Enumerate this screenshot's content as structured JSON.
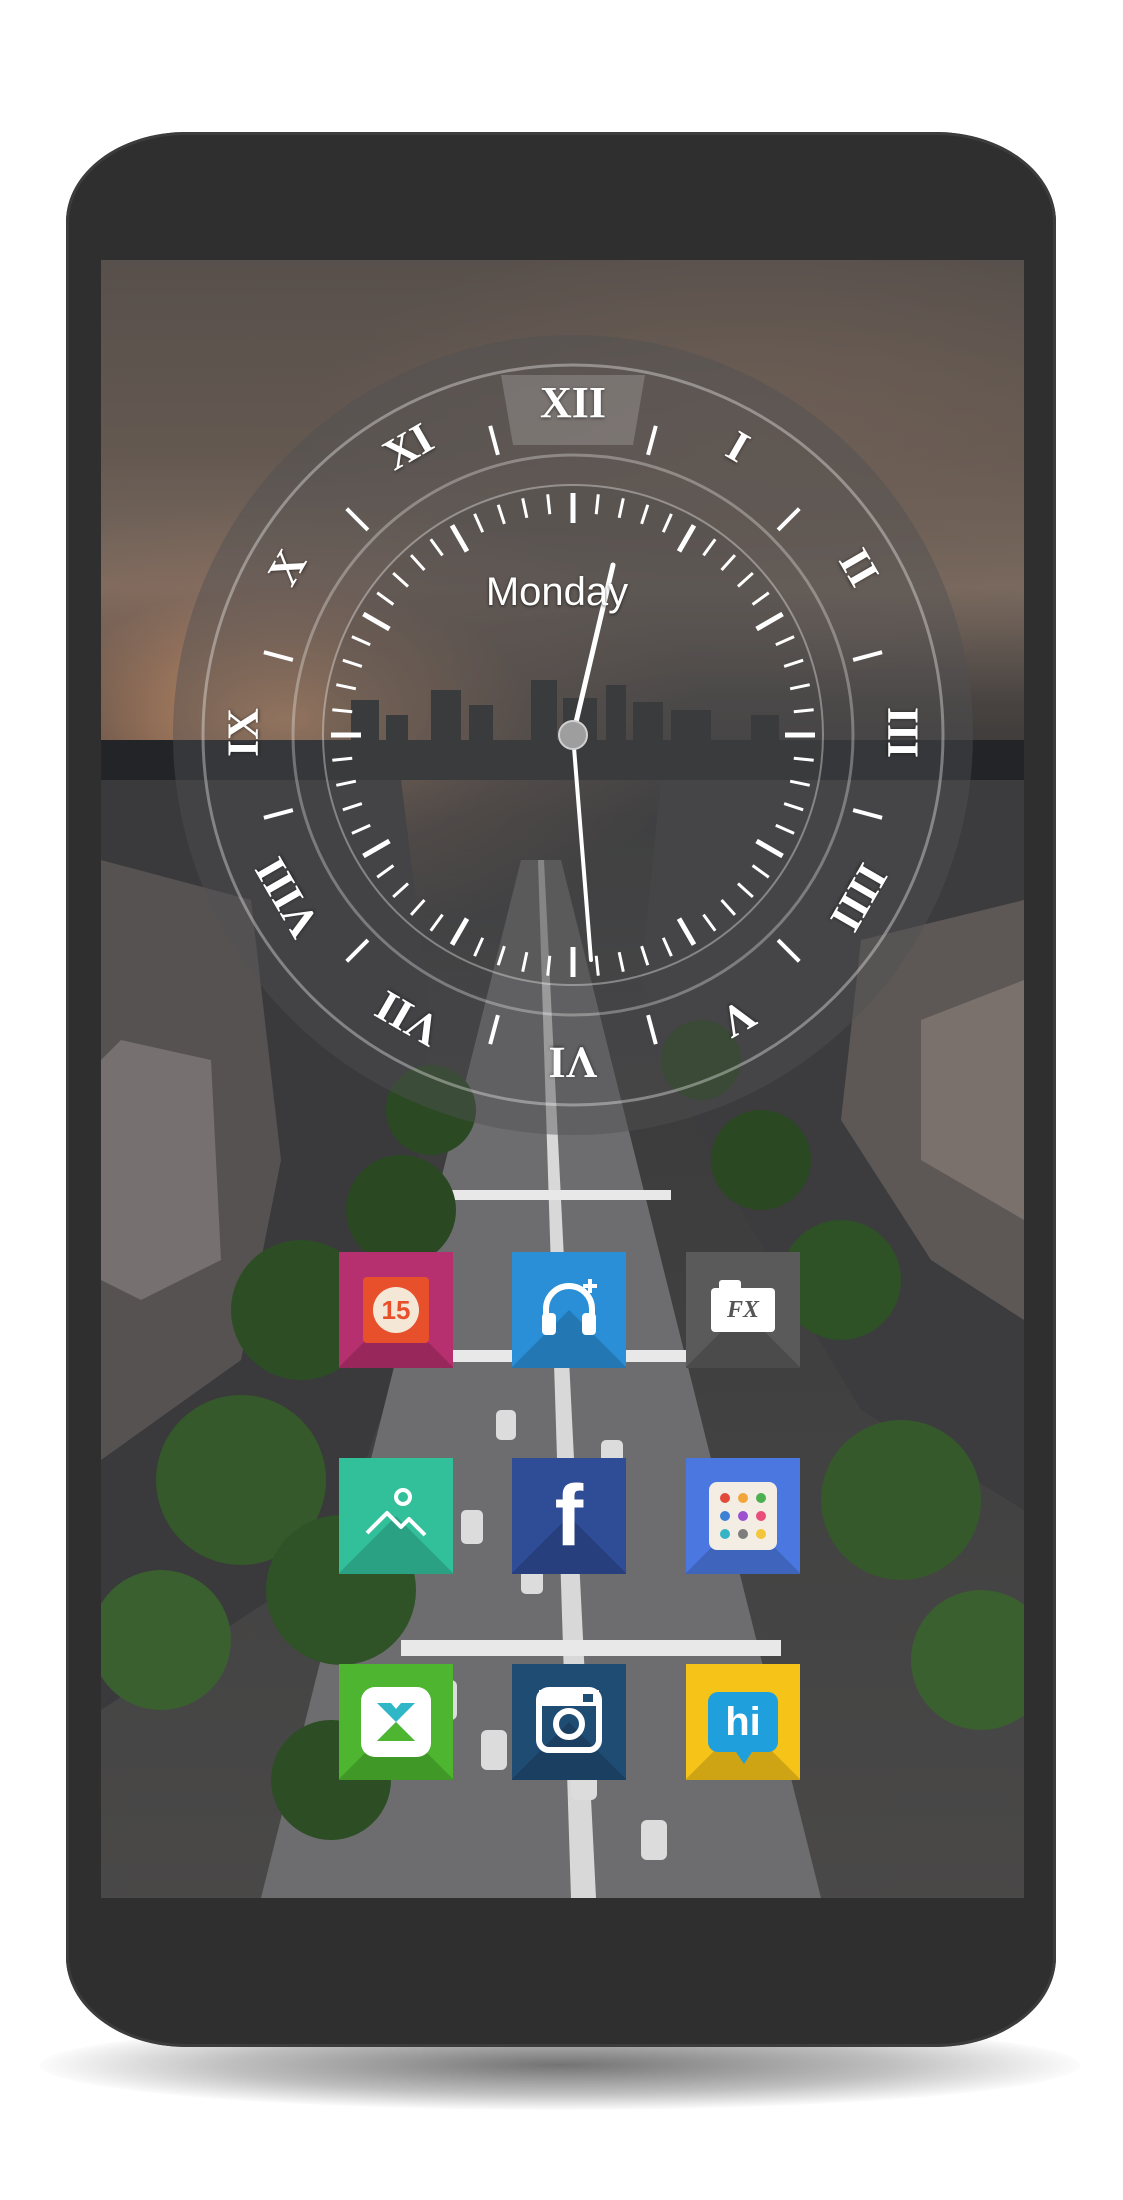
{
  "clock": {
    "day": "Monday",
    "numerals": [
      "XII",
      "I",
      "II",
      "III",
      "IIII",
      "V",
      "VI",
      "VII",
      "VIII",
      "IX",
      "X",
      "XI"
    ]
  },
  "apps": [
    {
      "name": "calendar-app",
      "icon": "calendar-icon",
      "color": "#b62f6e",
      "label": "15"
    },
    {
      "name": "music-app",
      "icon": "headphones-icon",
      "color": "#2a8fd6",
      "label": ""
    },
    {
      "name": "fx-file-explorer-app",
      "icon": "fx-folder-icon",
      "color": "#5a5a5a",
      "label": "FX"
    },
    {
      "name": "gallery-app",
      "icon": "mountain-icon",
      "color": "#32c09b",
      "label": ""
    },
    {
      "name": "facebook-app",
      "icon": "facebook-icon",
      "color": "#2f4d96",
      "label": "f"
    },
    {
      "name": "app-drawer",
      "icon": "dots-grid-icon",
      "color": "#4a78e0",
      "label": ""
    },
    {
      "name": "xender-app",
      "icon": "xender-icon",
      "color": "#4db52f",
      "label": ""
    },
    {
      "name": "instagram-app",
      "icon": "instagram-icon",
      "color": "#1f4c73",
      "label": ""
    },
    {
      "name": "hike-messenger-app",
      "icon": "hi-chat-icon",
      "color": "#f6c418",
      "label": "hi"
    }
  ]
}
